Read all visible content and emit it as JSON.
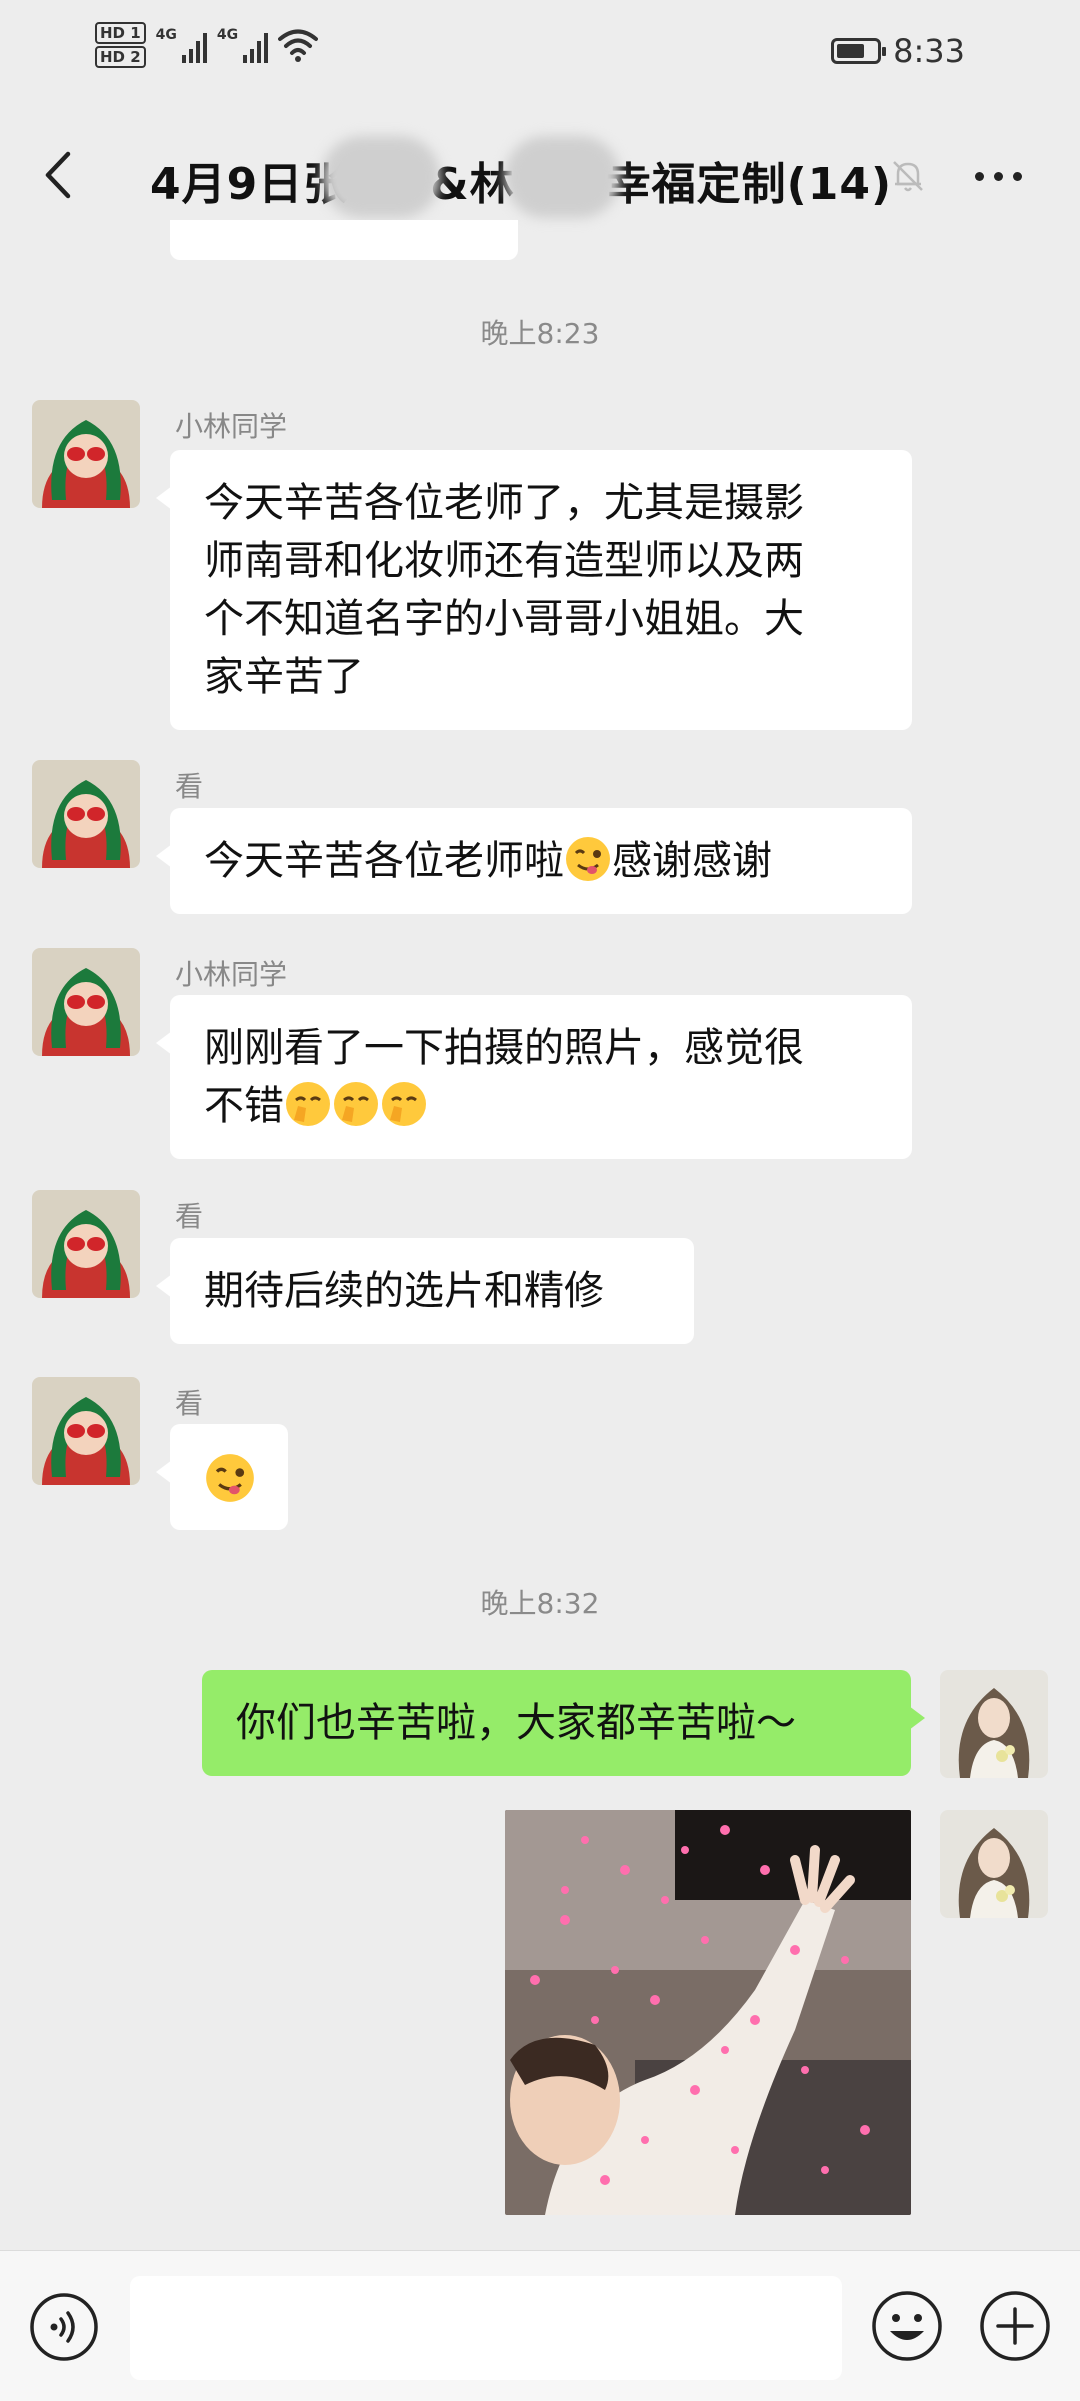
{
  "status_bar": {
    "sim1": "HD 1",
    "sim2": "HD 2",
    "net1": "4G",
    "net2": "4G",
    "time": "8:33"
  },
  "header": {
    "title_part1": "4月9日张",
    "title_part2": "&林",
    "title_part3": "幸福定制(14)"
  },
  "messages": [
    {
      "type": "timestamp",
      "text": "晚上8:23"
    },
    {
      "sender": "小林同学",
      "text_lines": [
        "今天辛苦各位老师了，尤其是摄影",
        "师南哥和化妆师还有造型师以及两",
        "个不知道名字的小哥哥小姐姐。大",
        "家辛苦了"
      ]
    },
    {
      "sender": "看",
      "text": "今天辛苦各位老师啦",
      "text_after": "感谢感谢"
    },
    {
      "sender": "小林同学",
      "text_lines": [
        "刚刚看了一下拍摄的照片，感觉很",
        "不错"
      ]
    },
    {
      "sender": "看",
      "text": "期待后续的选片和精修"
    },
    {
      "sender": "看",
      "emoji": "tongue-face"
    },
    {
      "type": "timestamp",
      "text": "晚上8:32"
    },
    {
      "sender": "me",
      "text": "你们也辛苦啦，大家都辛苦啦～"
    },
    {
      "sender": "me",
      "image": "baby-hearts-photo"
    }
  ],
  "colors": {
    "background": "#ededed",
    "my_bubble": "#95ec69",
    "other_bubble": "#ffffff"
  },
  "input_bar": {
    "left_icon": "voice-icon",
    "emoji_icon": "emoji-icon",
    "plus_icon": "plus-icon"
  }
}
